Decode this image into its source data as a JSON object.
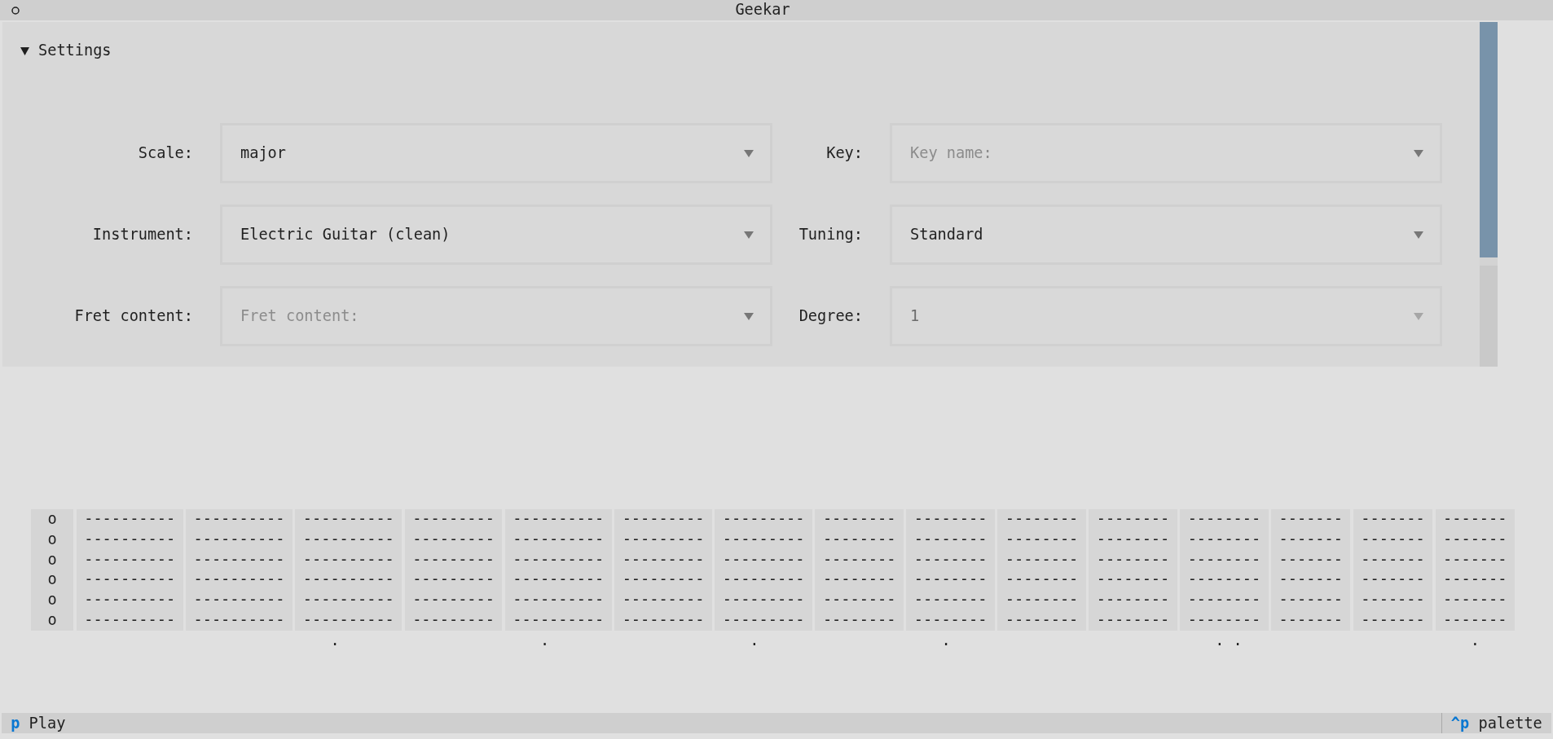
{
  "header": {
    "title": "Geekar"
  },
  "settings": {
    "title": "Settings",
    "expanded": true,
    "fields": [
      {
        "label": "Scale:",
        "value": "major",
        "disabled": false
      },
      {
        "label": "Key:",
        "placeholder": "Key name:",
        "disabled": false
      },
      {
        "label": "Instrument:",
        "value": "Electric Guitar (clean)",
        "disabled": false
      },
      {
        "label": "Tuning:",
        "value": "Standard",
        "disabled": false
      },
      {
        "label": "Fret content:",
        "placeholder": "Fret content:",
        "disabled": false
      },
      {
        "label": "Degree:",
        "value": "1",
        "disabled": true
      }
    ]
  },
  "fretboard": {
    "open_strings": [
      "o",
      "o",
      "o",
      "o",
      "o",
      "o"
    ],
    "frets": [
      {
        "strings": [
          "----------",
          "----------",
          "----------",
          "----------",
          "----------",
          "----------"
        ]
      },
      {
        "strings": [
          "----------",
          "----------",
          "----------",
          "----------",
          "----------",
          "----------"
        ]
      },
      {
        "strings": [
          "----------",
          "----------",
          "----------",
          "----------",
          "----------",
          "----------"
        ],
        "marker": "."
      },
      {
        "strings": [
          "---------",
          "---------",
          "---------",
          "---------",
          "---------",
          "---------"
        ]
      },
      {
        "strings": [
          "----------",
          "----------",
          "----------",
          "----------",
          "----------",
          "----------"
        ],
        "marker": "."
      },
      {
        "strings": [
          "---------",
          "---------",
          "---------",
          "---------",
          "---------",
          "---------"
        ]
      },
      {
        "strings": [
          "---------",
          "---------",
          "---------",
          "---------",
          "---------",
          "---------"
        ],
        "marker": "."
      },
      {
        "strings": [
          "--------",
          "--------",
          "--------",
          "--------",
          "--------",
          "--------"
        ]
      },
      {
        "strings": [
          "--------",
          "--------",
          "--------",
          "--------",
          "--------",
          "--------"
        ],
        "marker": "."
      },
      {
        "strings": [
          "--------",
          "--------",
          "--------",
          "--------",
          "--------",
          "--------"
        ]
      },
      {
        "strings": [
          "--------",
          "--------",
          "--------",
          "--------",
          "--------",
          "--------"
        ]
      },
      {
        "strings": [
          "--------",
          "--------",
          "--------",
          "--------",
          "--------",
          "--------"
        ],
        "marker": ". ."
      },
      {
        "strings": [
          "-------",
          "-------",
          "-------",
          "-------",
          "-------",
          "-------"
        ]
      },
      {
        "strings": [
          "-------",
          "-------",
          "-------",
          "-------",
          "-------",
          "-------"
        ]
      },
      {
        "strings": [
          "-------",
          "-------",
          "-------",
          "-------",
          "-------",
          "-------"
        ],
        "marker": "."
      }
    ]
  },
  "footer": {
    "bindings": [
      {
        "key": "p",
        "description": "Play"
      }
    ],
    "command_palette": {
      "key": "^p",
      "description": "palette"
    }
  }
}
